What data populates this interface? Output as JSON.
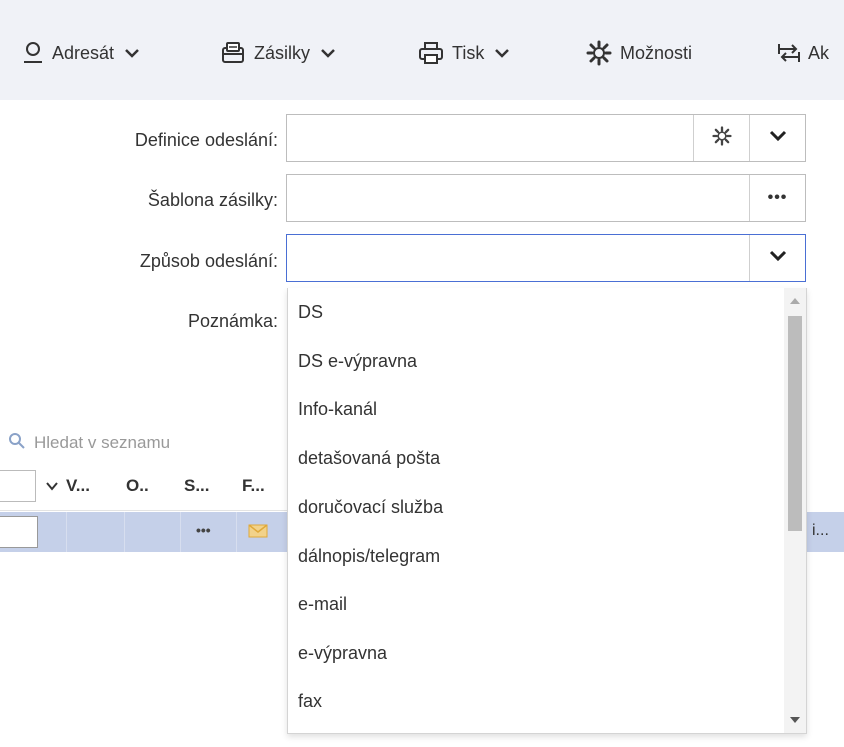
{
  "toolbar": {
    "items": [
      {
        "label": "Adresát",
        "icon": "user-icon"
      },
      {
        "label": "Zásilky",
        "icon": "parcel-icon"
      },
      {
        "label": "Tisk",
        "icon": "printer-icon"
      },
      {
        "label": "Možnosti",
        "icon": "gear-icon"
      },
      {
        "label": "Ak",
        "icon": "transfer-icon"
      }
    ]
  },
  "form": {
    "definice_label": "Definice odeslání:",
    "definice_value": "",
    "sablona_label": "Šablona zásilky:",
    "sablona_value": "",
    "zpusob_label": "Způsob odeslání:",
    "zpusob_value": "",
    "poznamka_label": "Poznámka:",
    "more_button": "•••"
  },
  "dropdown": {
    "options": [
      "DS",
      "DS e-výpravna",
      "Info-kanál",
      "detašovaná pošta",
      "doručovací služba",
      "dálnopis/telegram",
      "e-mail",
      "e-výpravna",
      "fax"
    ]
  },
  "list": {
    "search_placeholder": "Hledat v seznamu",
    "columns": [
      "V...",
      "O..",
      "S...",
      "F..."
    ],
    "row": {
      "more": "•••",
      "tail_text": "i..."
    }
  },
  "colors": {
    "toolbar_bg": "#f0f2f7",
    "focus_border": "#4a6fd4",
    "selected_row": "#c5d0e9"
  }
}
